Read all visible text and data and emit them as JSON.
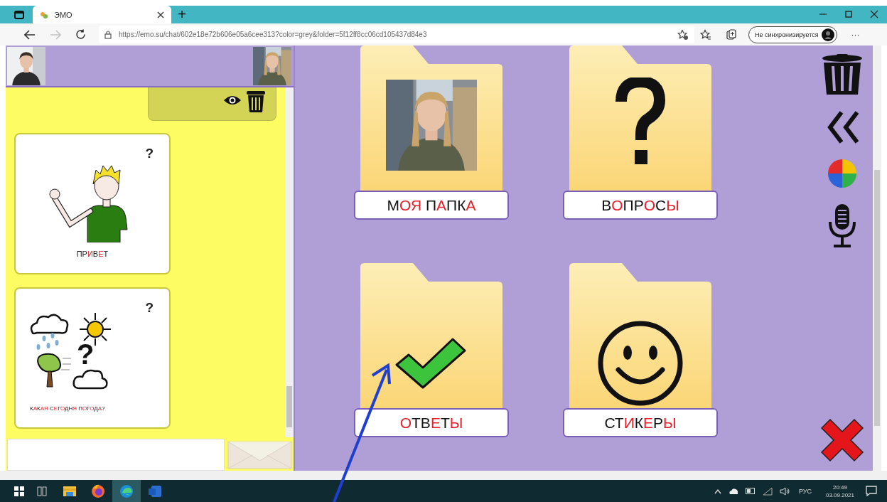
{
  "browser": {
    "tab": {
      "title": "ЭМО",
      "selected": true
    },
    "new_tab": "+",
    "nav": {
      "forward_disabled": true
    },
    "url": "https://emo.su/chat/602e18e72b606e05a6cee313?color=grey&folder=5f12ff8cc06cd105437d84e3",
    "profile": {
      "label": "Не синхронизируется"
    },
    "more": "···"
  },
  "chat": {
    "cards": [
      {
        "kind": "greeting",
        "mark": "?",
        "caption": [
          {
            "text": "ПР",
            "highlight": false
          },
          {
            "text": "И",
            "highlight": true
          },
          {
            "text": "В",
            "highlight": false
          },
          {
            "text": "Е",
            "highlight": true
          },
          {
            "text": "Т",
            "highlight": false
          }
        ]
      },
      {
        "kind": "weather",
        "mark": "?",
        "symbol": "?",
        "caption": [
          {
            "text": "К",
            "highlight": false
          },
          {
            "text": "А",
            "highlight": true
          },
          {
            "text": "К",
            "highlight": false
          },
          {
            "text": "АЯ",
            "highlight": true
          },
          {
            "text": " С",
            "highlight": false
          },
          {
            "text": "Е",
            "highlight": true
          },
          {
            "text": "Г",
            "highlight": false
          },
          {
            "text": "О",
            "highlight": true
          },
          {
            "text": "ДН",
            "highlight": false
          },
          {
            "text": "Я",
            "highlight": true
          },
          {
            "text": " П",
            "highlight": false
          },
          {
            "text": "О",
            "highlight": true
          },
          {
            "text": "Г",
            "highlight": false
          },
          {
            "text": "О",
            "highlight": true
          },
          {
            "text": "Д",
            "highlight": false
          },
          {
            "text": "А",
            "highlight": true
          },
          {
            "text": "?",
            "highlight": false
          }
        ]
      }
    ]
  },
  "folders": [
    {
      "label": [
        {
          "text": "М",
          "highlight": false
        },
        {
          "text": "ОЯ",
          "highlight": true
        },
        {
          "text": " П",
          "highlight": false
        },
        {
          "text": "А",
          "highlight": true
        },
        {
          "text": "ПК",
          "highlight": false
        },
        {
          "text": "А",
          "highlight": true
        }
      ]
    },
    {
      "kind": "question",
      "label": [
        {
          "text": "В",
          "highlight": false
        },
        {
          "text": "О",
          "highlight": true
        },
        {
          "text": "ПР",
          "highlight": false
        },
        {
          "text": "О",
          "highlight": true
        },
        {
          "text": "С",
          "highlight": false
        },
        {
          "text": "Ы",
          "highlight": true
        }
      ]
    },
    {
      "kind": "check",
      "label": [
        {
          "text": "О",
          "highlight": true
        },
        {
          "text": "ТВ",
          "highlight": false
        },
        {
          "text": "Е",
          "highlight": true
        },
        {
          "text": "Т",
          "highlight": false
        },
        {
          "text": "Ы",
          "highlight": true
        }
      ]
    },
    {
      "kind": "smiley",
      "label": [
        {
          "text": "СТ",
          "highlight": false
        },
        {
          "text": "И",
          "highlight": true
        },
        {
          "text": "К",
          "highlight": false
        },
        {
          "text": "Е",
          "highlight": true
        },
        {
          "text": "Р",
          "highlight": false
        },
        {
          "text": "Ы",
          "highlight": true
        }
      ]
    }
  ],
  "taskbar": {
    "apps": [
      {
        "kind": "explorer",
        "selected": false
      },
      {
        "kind": "firefox",
        "selected": false
      },
      {
        "kind": "edge",
        "selected": true
      },
      {
        "kind": "word",
        "selected": false
      }
    ],
    "language": "РУС",
    "time": "20:49",
    "date": "03.09.2021"
  }
}
